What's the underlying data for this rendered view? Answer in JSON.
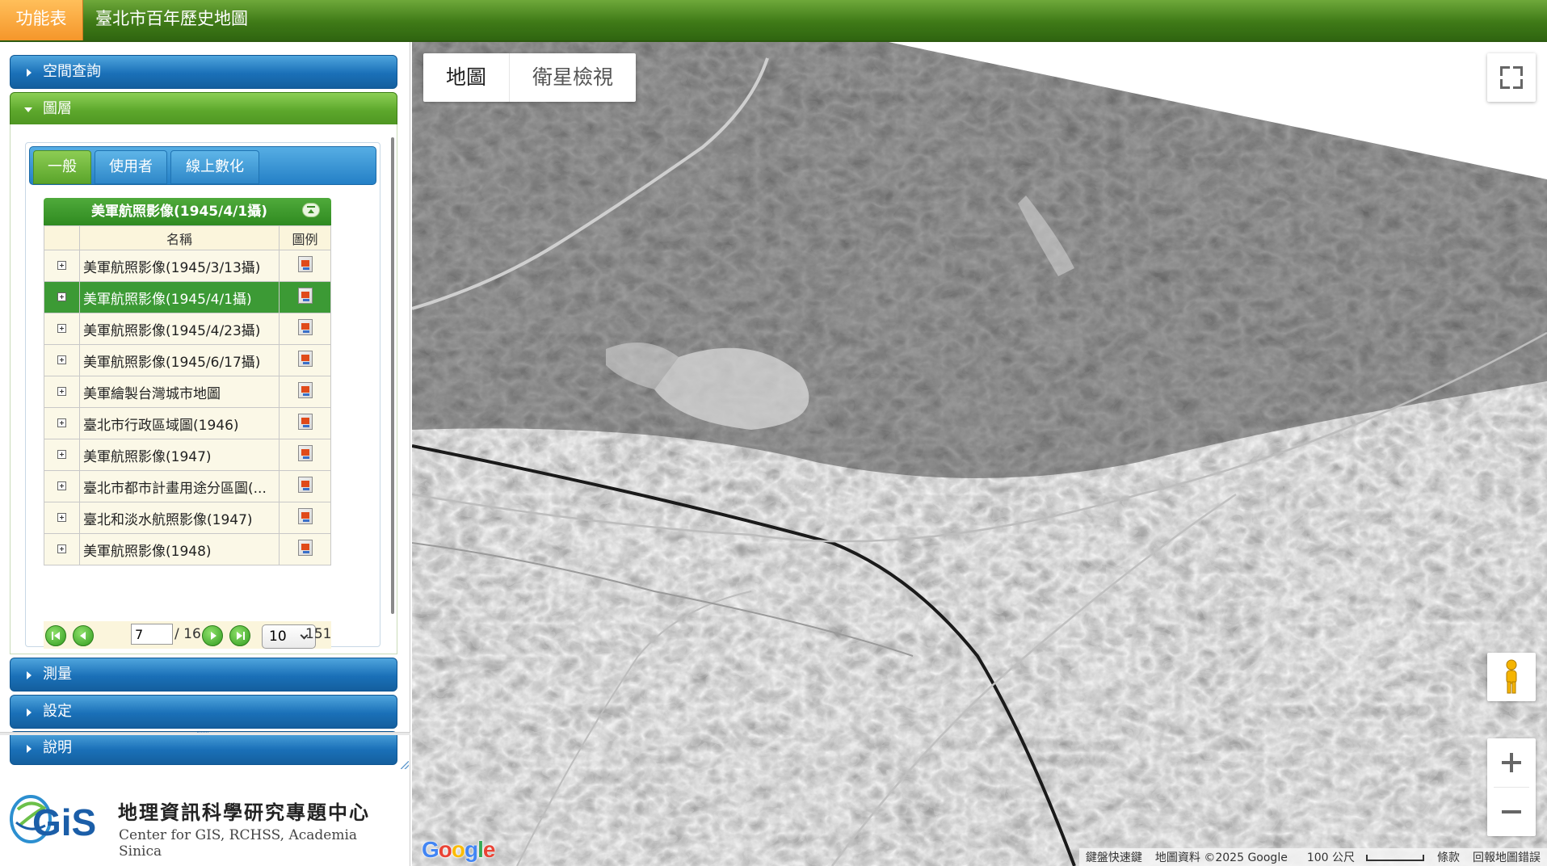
{
  "topbar": {
    "menu_label": "功能表",
    "title": "臺北市百年歷史地圖"
  },
  "sidebar": {
    "sections": [
      {
        "label": "空間查詢"
      },
      {
        "label": "圖層"
      },
      {
        "label": "測量"
      },
      {
        "label": "設定"
      },
      {
        "label": "說明"
      }
    ],
    "tabs": [
      {
        "label": "一般",
        "active": true
      },
      {
        "label": "使用者",
        "active": false
      },
      {
        "label": "線上數化",
        "active": false
      }
    ],
    "layer_grid": {
      "title": "美軍航照影像(1945/4/1攝)",
      "columns": {
        "name": "名稱",
        "legend": "圖例"
      },
      "rows": [
        {
          "name": "美軍航照影像(1945/3/13攝)",
          "selected": false
        },
        {
          "name": "美軍航照影像(1945/4/1攝)",
          "selected": true
        },
        {
          "name": "美軍航照影像(1945/4/23攝)",
          "selected": false
        },
        {
          "name": "美軍航照影像(1945/6/17攝)",
          "selected": false
        },
        {
          "name": "美軍繪製台灣城市地圖",
          "selected": false
        },
        {
          "name": "臺北市行政區域圖(1946)",
          "selected": false
        },
        {
          "name": "美軍航照影像(1947)",
          "selected": false
        },
        {
          "name": "臺北市都市計畫用途分區圖(...",
          "selected": false
        },
        {
          "name": "臺北和淡水航照影像(1947)",
          "selected": false
        },
        {
          "name": "美軍航照影像(1948)",
          "selected": false
        }
      ],
      "pager": {
        "current_page": "7",
        "total_pages_text": "/ 16",
        "page_size": "10",
        "total_records": "151"
      }
    }
  },
  "logo": {
    "mark_text": "GiS",
    "name_cn": "地理資訊科學研究專題中心",
    "name_en": "Center for GIS, RCHSS, Academia Sinica"
  },
  "map": {
    "map_type_buttons": [
      {
        "label": "地圖"
      },
      {
        "label": "衛星檢視"
      }
    ],
    "google_logo": "Google",
    "attribution": {
      "shortcuts": "鍵盤快速鍵",
      "data": "地圖資料 ©2025 Google",
      "scale": "100 公尺",
      "terms": "條款",
      "report": "回報地圖錯誤"
    }
  },
  "colors": {
    "topbar_green": "#3f7a17",
    "menu_orange": "#f5962a",
    "accordion_blue": "#1a70b8",
    "accordion_green": "#5da82c",
    "selected_row": "#3c9a35"
  }
}
